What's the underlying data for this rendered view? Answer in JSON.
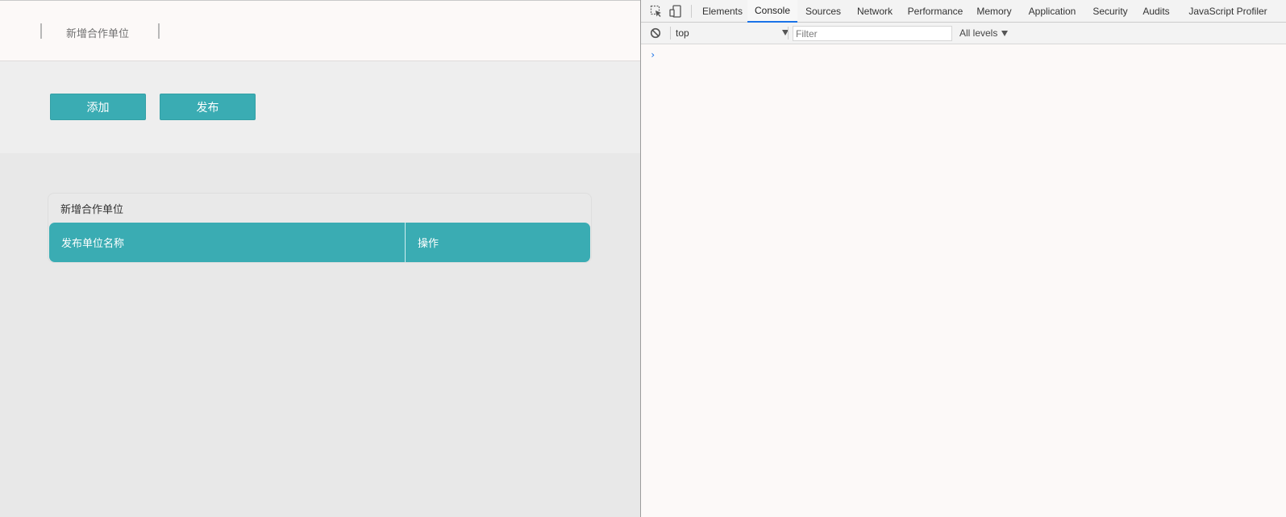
{
  "app": {
    "nav_title": "新增合作单位",
    "buttons": {
      "add_label": "添加",
      "publish_label": "发布"
    },
    "panel": {
      "title": "新增合作单位",
      "columns": [
        "发布单位名称",
        "操作"
      ]
    },
    "colors": {
      "accent": "#3aacb3"
    }
  },
  "devtools": {
    "icons": [
      "inspect-element-icon",
      "device-toolbar-icon",
      "clear-console-icon"
    ],
    "tabs": [
      "Elements",
      "Console",
      "Sources",
      "Network",
      "Performance",
      "Memory",
      "Application",
      "Security",
      "Audits",
      "JavaScript Profiler"
    ],
    "active_tab": "Console",
    "console": {
      "context": "top",
      "filter_placeholder": "Filter",
      "levels": "All levels",
      "prompt": "›"
    },
    "colors": {
      "active_tab_underline": "#1a73e8"
    }
  }
}
